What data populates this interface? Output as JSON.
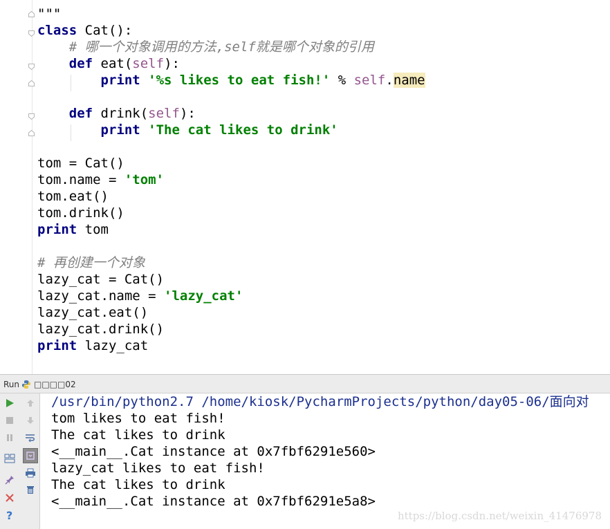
{
  "editor": {
    "lines": [
      {
        "text": "\"\"\"",
        "parts": [
          {
            "t": "\"\"\"",
            "c": ""
          }
        ]
      },
      {
        "parts": [
          {
            "t": "class",
            "c": "kw"
          },
          {
            "t": " Cat():",
            "c": ""
          }
        ]
      },
      {
        "parts": [
          {
            "t": "    # 哪一个对象调用的方法,self就是哪个对象的引用",
            "c": "cmt"
          }
        ]
      },
      {
        "parts": [
          {
            "t": "    ",
            "c": ""
          },
          {
            "t": "def",
            "c": "kw"
          },
          {
            "t": " eat(",
            "c": ""
          },
          {
            "t": "self",
            "c": "selfkw"
          },
          {
            "t": "):",
            "c": ""
          }
        ]
      },
      {
        "parts": [
          {
            "t": "        ",
            "c": ""
          },
          {
            "t": "print",
            "c": "kw"
          },
          {
            "t": " ",
            "c": ""
          },
          {
            "t": "'%s likes to eat fish!'",
            "c": "str"
          },
          {
            "t": " % ",
            "c": ""
          },
          {
            "t": "self",
            "c": "selfkw"
          },
          {
            "t": ".",
            "c": ""
          },
          {
            "t": "name",
            "c": "hl"
          }
        ]
      },
      {
        "parts": [
          {
            "t": "",
            "c": ""
          }
        ]
      },
      {
        "parts": [
          {
            "t": "    ",
            "c": ""
          },
          {
            "t": "def",
            "c": "kw"
          },
          {
            "t": " drink(",
            "c": ""
          },
          {
            "t": "self",
            "c": "selfkw"
          },
          {
            "t": "):",
            "c": ""
          }
        ]
      },
      {
        "parts": [
          {
            "t": "        ",
            "c": ""
          },
          {
            "t": "print",
            "c": "kw"
          },
          {
            "t": " ",
            "c": ""
          },
          {
            "t": "'The cat likes to drink'",
            "c": "str"
          }
        ]
      },
      {
        "parts": [
          {
            "t": "",
            "c": ""
          }
        ]
      },
      {
        "parts": [
          {
            "t": "tom = Cat()",
            "c": ""
          }
        ]
      },
      {
        "parts": [
          {
            "t": "tom.name = ",
            "c": ""
          },
          {
            "t": "'tom'",
            "c": "str"
          }
        ]
      },
      {
        "parts": [
          {
            "t": "tom.eat()",
            "c": ""
          }
        ]
      },
      {
        "parts": [
          {
            "t": "tom.drink()",
            "c": ""
          }
        ]
      },
      {
        "parts": [
          {
            "t": "print",
            "c": "kw"
          },
          {
            "t": " tom",
            "c": ""
          }
        ]
      },
      {
        "parts": [
          {
            "t": "",
            "c": ""
          }
        ]
      },
      {
        "parts": [
          {
            "t": "# 再创建一个对象",
            "c": "cmt"
          }
        ]
      },
      {
        "parts": [
          {
            "t": "lazy_cat = Cat()",
            "c": ""
          }
        ]
      },
      {
        "parts": [
          {
            "t": "lazy_cat.name = ",
            "c": ""
          },
          {
            "t": "'lazy_cat'",
            "c": "str"
          }
        ]
      },
      {
        "parts": [
          {
            "t": "lazy_cat.eat()",
            "c": ""
          }
        ]
      },
      {
        "parts": [
          {
            "t": "lazy_cat.drink()",
            "c": ""
          }
        ]
      },
      {
        "parts": [
          {
            "t": "print",
            "c": "kw"
          },
          {
            "t": " lazy_cat",
            "c": ""
          }
        ]
      }
    ]
  },
  "run_panel": {
    "label": "Run",
    "config_name": "□□□□02",
    "toolbar_icons": [
      "run-icon",
      "stop-icon",
      "pause-icon",
      "layout-icon",
      "pin-icon",
      "close-icon",
      "help-icon",
      "up-arrow-icon",
      "down-arrow-icon",
      "soft-wrap-icon",
      "scroll-to-end-icon",
      "print-icon",
      "trash-icon"
    ],
    "output": [
      "/usr/bin/python2.7 /home/kiosk/PycharmProjects/python/day05-06/面向对",
      "tom likes to eat fish!",
      "The cat likes to drink",
      "<__main__.Cat instance at 0x7fbf6291e560>",
      "lazy_cat likes to eat fish!",
      "The cat likes to drink",
      "<__main__.Cat instance at 0x7fbf6291e5a8>"
    ]
  },
  "watermark": "https://blog.csdn.net/weixin_41476978",
  "colors": {
    "keyword": "#000080",
    "string": "#008000",
    "self": "#94558d",
    "comment": "#808080",
    "highlight": "#f6ebbc",
    "command": "#1b2f8f"
  }
}
